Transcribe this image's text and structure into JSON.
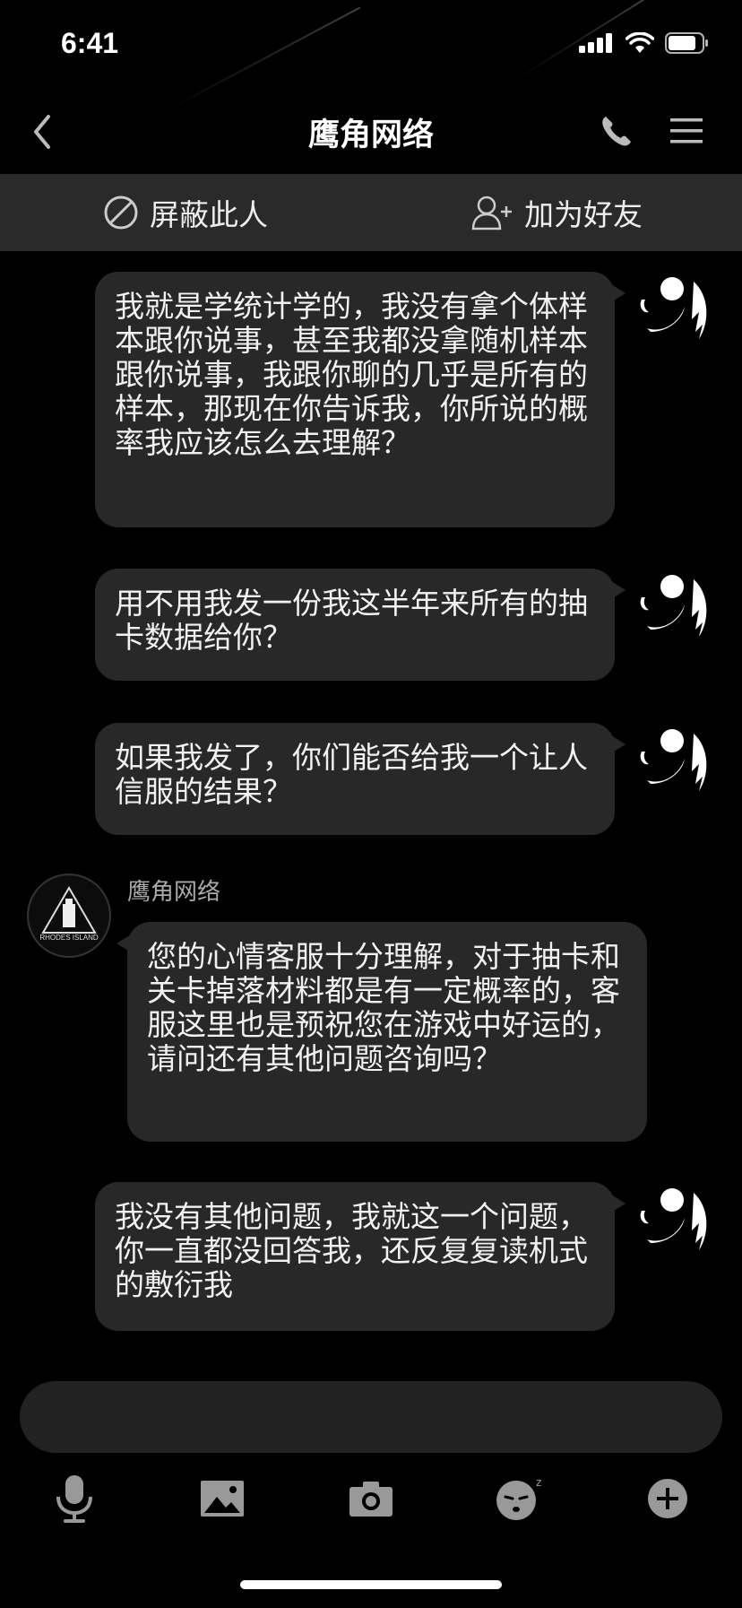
{
  "status_bar": {
    "time": "6:41"
  },
  "header": {
    "title": "鹰角网络"
  },
  "actions": {
    "block_label": "屏蔽此人",
    "add_friend_label": "加为好友"
  },
  "messages": [
    {
      "text": "我就是学统计学的，我没有拿个体样本跟你说事，甚至我都没拿随机样本跟你说事，我跟你聊的几乎是所有的样本，那现在你告诉我，你所说的概率我应该怎么去理解？"
    },
    {
      "text": "用不用我发一份我这半年来所有的抽卡数据给你？"
    },
    {
      "text": "如果我发了，你们能否给我一个让人信服的结果？"
    },
    {
      "sender": "鹰角网络",
      "text": "您的心情客服十分理解，对于抽卡和关卡掉落材料都是有一定概率的，客服这里也是预祝您在游戏中好运的，请问还有其他问题咨询吗？"
    },
    {
      "text": "我没有其他问题，我就这一个问题，你一直都没回答我，还反复复读机式的敷衍我"
    }
  ],
  "avatar_text": "RHODES ISLAND",
  "colors": {
    "background": "#000000",
    "bubble": "#282828",
    "action_bar": "#2a2a2a"
  }
}
